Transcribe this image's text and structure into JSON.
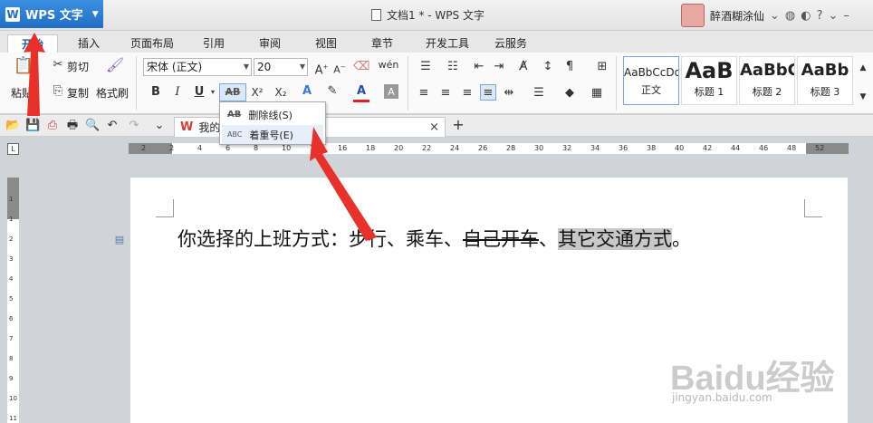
{
  "app": {
    "name": "WPS 文字",
    "logo": "W"
  },
  "window": {
    "title": "文档1 * - WPS 文字",
    "user_name": "醉酒糊涂仙"
  },
  "tabs": [
    "开始",
    "插入",
    "页面布局",
    "引用",
    "审阅",
    "视图",
    "章节",
    "开发工具",
    "云服务"
  ],
  "ribbon": {
    "paste": "粘贴",
    "cut": "剪切",
    "copy": "复制",
    "format_painter": "格式刷",
    "font_name": "宋体 (正文)",
    "font_size": "20",
    "bold": "B",
    "italic": "I",
    "underline": "U",
    "strike_btn": "AB",
    "superscript": "X²",
    "subscript": "X₂",
    "styles": [
      {
        "sample": "AaBbCcDd",
        "name": "正文"
      },
      {
        "sample": "AaB",
        "name": "标题 1"
      },
      {
        "sample": "AaBbC",
        "name": "标题 2"
      },
      {
        "sample": "AaBb",
        "name": "标题 3"
      }
    ]
  },
  "doc_tab": {
    "label": "我的W",
    "close": "×",
    "add": "+"
  },
  "dropdown": [
    {
      "label": "删除线(S)",
      "icon_text": "AB"
    },
    {
      "label": "着重号(E)",
      "icon_text": "ABC"
    }
  ],
  "ruler": {
    "h_numbers": [
      "2",
      "2",
      "4",
      "6",
      "8",
      "10",
      "14",
      "16",
      "18",
      "20",
      "22",
      "24",
      "26",
      "28",
      "30",
      "32",
      "34",
      "36",
      "38",
      "40",
      "42",
      "44",
      "46",
      "48",
      "52"
    ],
    "v_numbers": [
      "1",
      "1",
      "2",
      "3",
      "4",
      "5",
      "6",
      "7",
      "8",
      "9",
      "10",
      "11"
    ]
  },
  "document": {
    "part1": "你选择的上班方式：步行、乘车、",
    "strike": "自己开车",
    "part2": "、",
    "highlighted": "其它交通方式",
    "end": "。"
  },
  "watermark": {
    "brand": "Baidu经验",
    "url": "jingyan.baidu.com"
  }
}
